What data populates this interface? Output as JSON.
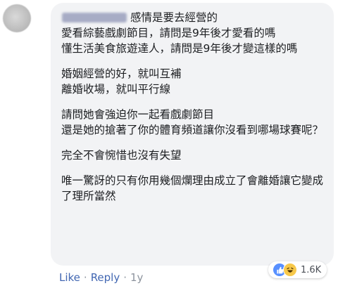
{
  "comment": {
    "lines": [
      "感情是要去經營的",
      "愛看綜藝戲劇節目，請問是9年後才愛看的嗎",
      "懂生活美食旅遊達人，請問是9年後才變這樣的嗎",
      "婚姻經營的好，就叫互補\n離婚收場，就叫平行線",
      "請問她會強迫你一起看戲劇節目\n還是她的搶著了你的體育頻道讓你沒看到哪場球賽呢？",
      "完全不會惋惜也沒有失望",
      "唯一驚訝的只有你用幾個爛理由成立了會離婚讓它變成了理所當然"
    ]
  },
  "actions": {
    "like": "Like",
    "sep": "·",
    "reply": "Reply",
    "age": "1y"
  },
  "reactions": {
    "count": "1.6K",
    "icons": [
      "thumbs-up-icon",
      "haha-icon"
    ],
    "colors": {
      "like": "#5890ff",
      "haha": "#f7c84a"
    }
  }
}
